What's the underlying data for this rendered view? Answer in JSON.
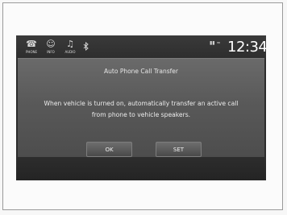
{
  "status_bar": {
    "items": [
      {
        "icon": "phone-icon",
        "glyph": "☎",
        "caption": "PHONE"
      },
      {
        "icon": "info-icon",
        "glyph": "☺",
        "caption": "INFO"
      },
      {
        "icon": "audio-icon",
        "glyph": "♫",
        "caption": "AUDIO"
      }
    ],
    "bluetooth_icon": "bluetooth-icon",
    "signal_text": "▮▮ ≈",
    "time": "12:34"
  },
  "dialog": {
    "title": "Auto Phone Call Transfer",
    "message": "When vehicle is turned on, automatically transfer an active call from phone to vehicle speakers.",
    "buttons": {
      "ok": "OK",
      "set": "SET"
    }
  },
  "colors": {
    "screen_bg": "#2c2c2c",
    "dialog_bg": "#5a5a5a",
    "text": "#ececec"
  }
}
